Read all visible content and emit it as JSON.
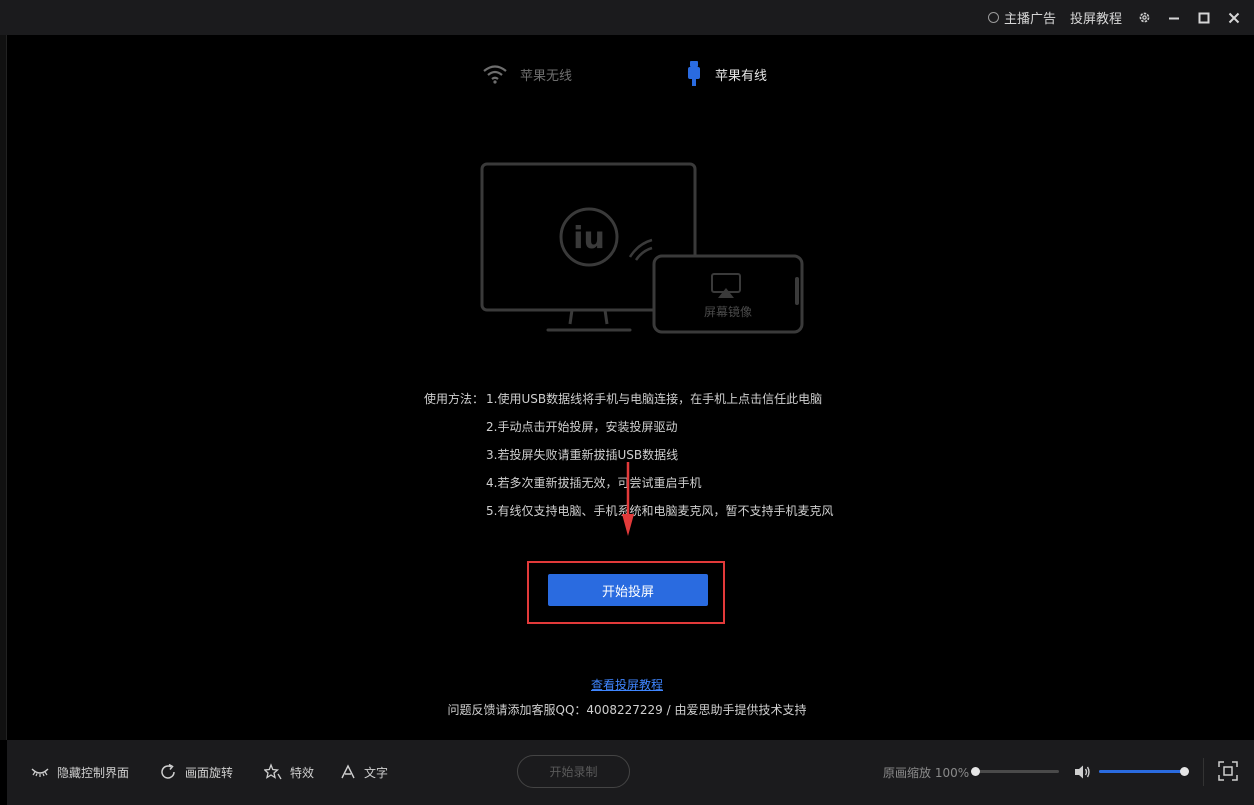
{
  "titlebar": {
    "ad_label": "主播广告",
    "tutorial_label": "投屏教程"
  },
  "tabs": [
    {
      "label": "苹果无线",
      "icon": "wifi-icon",
      "active": false
    },
    {
      "label": "苹果有线",
      "icon": "usb-plug-icon",
      "active": true
    }
  ],
  "illustration": {
    "caption": "屏幕镜像",
    "logo_text": "iu"
  },
  "instructions": {
    "label": "使用方法：",
    "steps": [
      "1.使用USB数据线将手机与电脑连接，在手机上点击信任此电脑",
      "2.手动点击开始投屏，安装投屏驱动",
      "3.若投屏失败请重新拔插USB数据线",
      "4.若多次重新拔插无效，可尝试重启手机",
      "5.有线仅支持电脑、手机系统和电脑麦克风，暂不支持手机麦克风"
    ]
  },
  "start_button": "开始投屏",
  "footer": {
    "tutorial_link": "查看投屏教程",
    "support_text": "问题反馈请添加客服QQ：4008227229  /  由爱思助手提供技术支持"
  },
  "bottombar": {
    "hide_controls": "隐藏控制界面",
    "rotate": "画面旋转",
    "effects": "特效",
    "text": "文字",
    "record": "开始录制",
    "zoom_label": "原画缩放 100%",
    "zoom_fraction": 0.0,
    "volume_fraction": 1.0
  },
  "colors": {
    "accent": "#2a6be0",
    "highlight": "#e23a3a",
    "link": "#3f86ff"
  }
}
